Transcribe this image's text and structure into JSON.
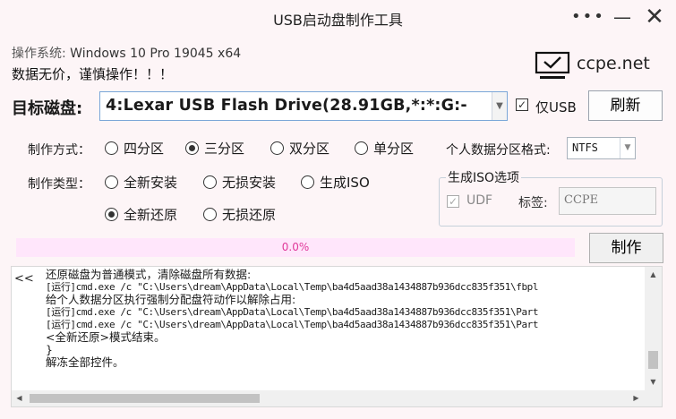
{
  "window": {
    "title": "USB启动盘制作工具",
    "menu_icon": "more-dots-icon",
    "min_glyph": "—",
    "close_glyph": "✕"
  },
  "info": {
    "os_label": "操作系统:",
    "os_value": "Windows 10 Pro 19045 x64",
    "warning": "数据无价，谨慎操作！！！"
  },
  "logo": {
    "icon": "monitor-check-icon",
    "text": "ccpe.net"
  },
  "target": {
    "label": "目标磁盘:",
    "disk_value": "4:Lexar   USB Flash Drive(28.91GB,*:*:G:-",
    "usb_only_checked": true,
    "usb_only_label": "仅USB",
    "refresh_label": "刷新"
  },
  "mode": {
    "label": "制作方式：",
    "options": [
      {
        "label": "四分区",
        "selected": false
      },
      {
        "label": "三分区",
        "selected": true
      },
      {
        "label": "双分区",
        "selected": false
      },
      {
        "label": "单分区",
        "selected": false
      }
    ]
  },
  "fs": {
    "label": "个人数据分区格式:",
    "value": "NTFS"
  },
  "type": {
    "label": "制作类型：",
    "options": [
      {
        "label": "全新安装",
        "selected": false
      },
      {
        "label": "无损安装",
        "selected": false
      },
      {
        "label": "生成ISO",
        "selected": false
      },
      {
        "label": "全新还原",
        "selected": true
      },
      {
        "label": "无损还原",
        "selected": false
      }
    ]
  },
  "iso": {
    "legend": "生成ISO选项",
    "udf_label": "UDF",
    "udf_checked": true,
    "tag_label": "标签:",
    "tag_value": "CCPE"
  },
  "progress": {
    "text": "0.0%",
    "value": 0,
    "colors": {
      "track": "#ffe6fb",
      "text": "#e0399a"
    }
  },
  "make_label": "制作",
  "log": {
    "prefix": "<<",
    "lines": [
      {
        "text": "还原磁盘为普通模式，清除磁盘所有数据:",
        "mono": false
      },
      {
        "text": "[运行]cmd.exe /c \"C:\\Users\\dream\\AppData\\Local\\Temp\\ba4d5aad38a1434887b936dcc835f351\\fbpl",
        "mono": true
      },
      {
        "text": "给个人数据分区执行强制分配盘符动作以解除占用:",
        "mono": false
      },
      {
        "text": "[运行]cmd.exe /c \"C:\\Users\\dream\\AppData\\Local\\Temp\\ba4d5aad38a1434887b936dcc835f351\\Part",
        "mono": true
      },
      {
        "text": "[运行]cmd.exe /c \"C:\\Users\\dream\\AppData\\Local\\Temp\\ba4d5aad38a1434887b936dcc835f351\\Part",
        "mono": true
      },
      {
        "text": "<全新还原>模式结束。",
        "mono": false
      },
      {
        "text": "}",
        "mono": false
      },
      {
        "text": "解冻全部控件。",
        "mono": false
      }
    ]
  }
}
